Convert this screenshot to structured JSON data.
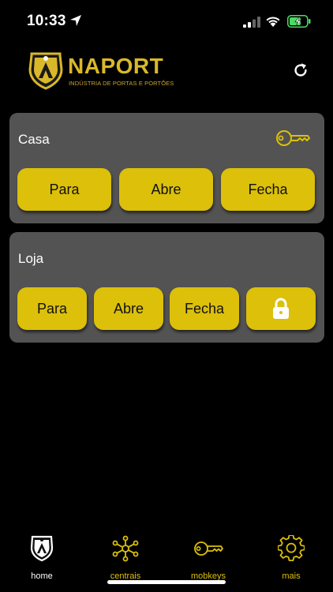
{
  "status_bar": {
    "time": "10:33"
  },
  "header": {
    "brand": "NAPORT",
    "tagline": "INDÚSTRIA DE PORTAS E PORTÕES"
  },
  "cards": [
    {
      "name": "Casa",
      "buttons": [
        "Para",
        "Abre",
        "Fecha"
      ]
    },
    {
      "name": "Loja",
      "buttons": [
        "Para",
        "Abre",
        "Fecha"
      ]
    }
  ],
  "tabs": [
    {
      "label": "home",
      "icon": "home-shield-icon"
    },
    {
      "label": "centrais",
      "icon": "network-icon"
    },
    {
      "label": "mobkeys",
      "icon": "key-icon"
    },
    {
      "label": "mais",
      "icon": "gear-icon"
    }
  ],
  "colors": {
    "accent": "#dcc00a",
    "card_bg": "#535353",
    "background": "#000000",
    "logo_gold": "#d9b82a",
    "battery_green": "#4cd964"
  }
}
